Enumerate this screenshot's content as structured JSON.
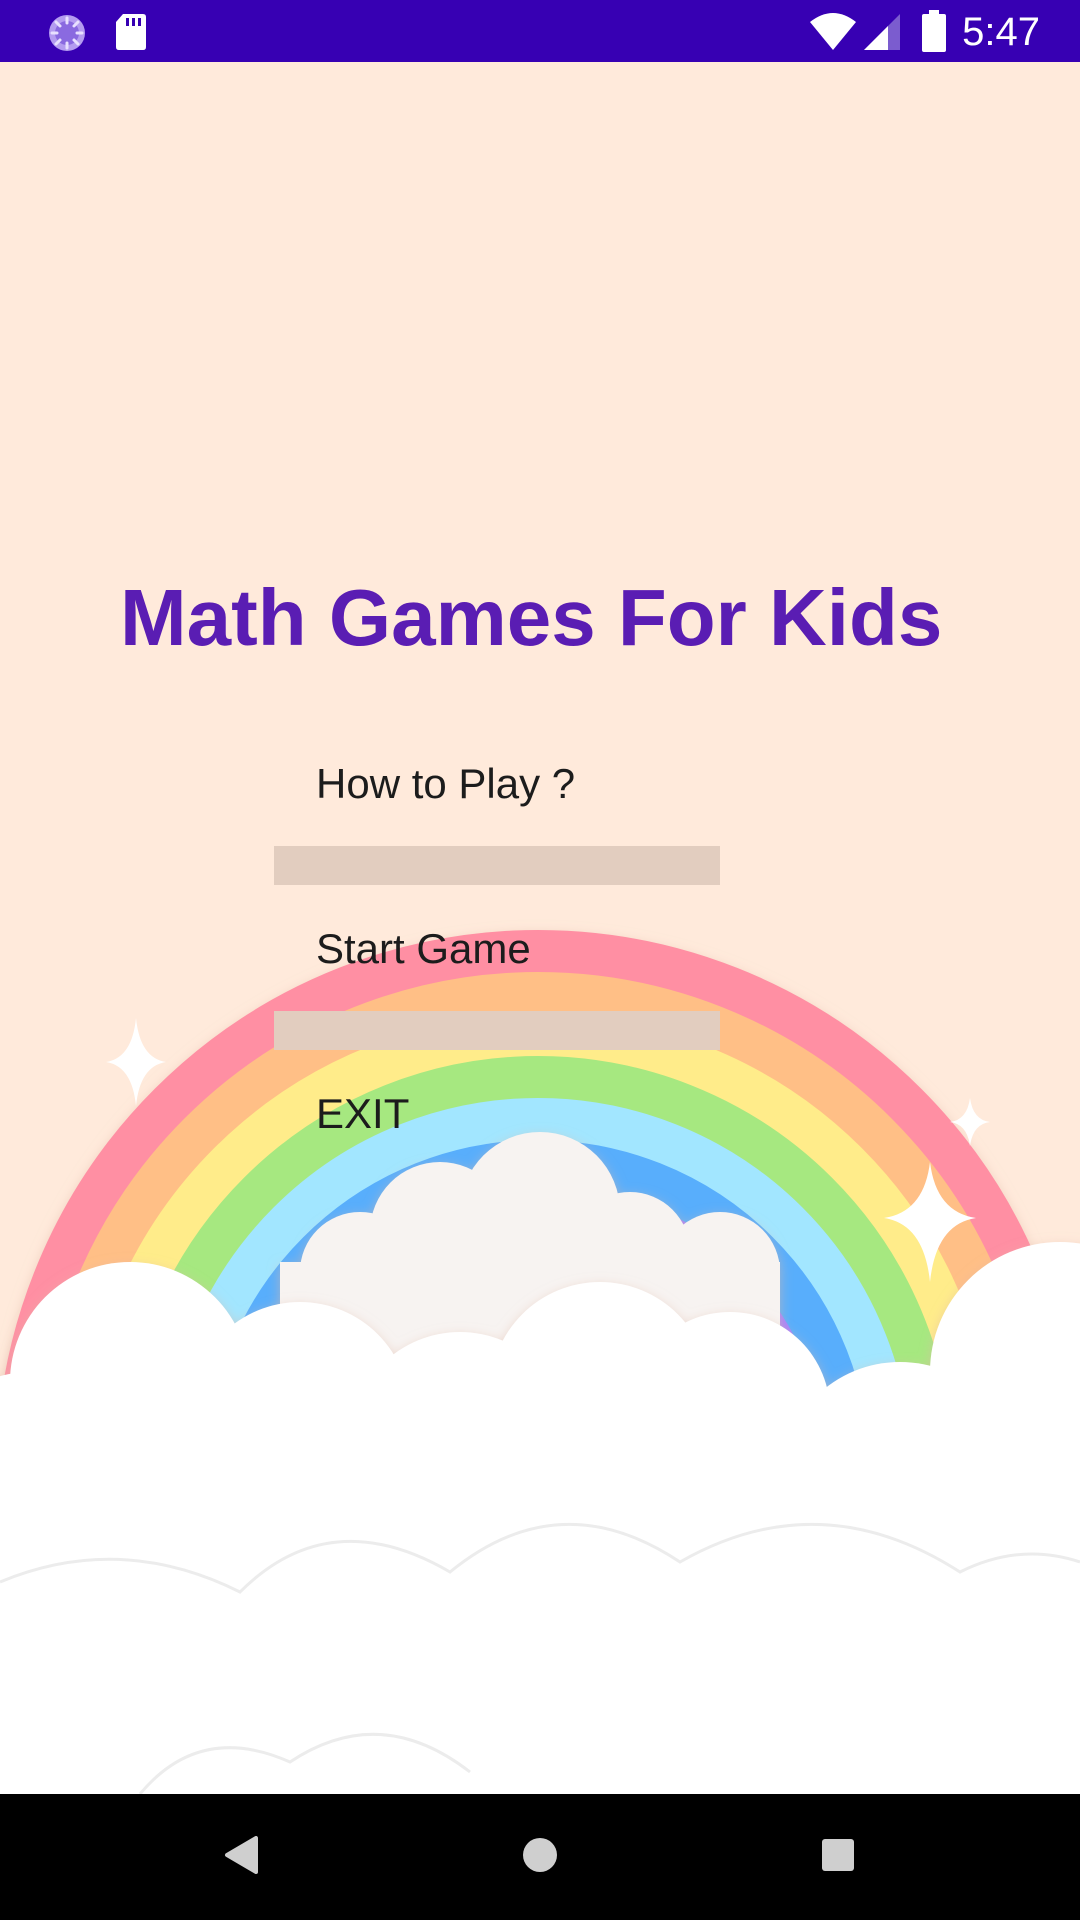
{
  "status_bar": {
    "time": "5:47",
    "background_color": "#3700b3",
    "left_icons": [
      "loading-icon",
      "sd-card-icon"
    ],
    "right_icons": [
      "wifi-icon",
      "signal-icon",
      "battery-icon"
    ]
  },
  "main": {
    "background_color": "#ffeadb",
    "title": "Math Games For Kids",
    "title_color": "#5a1db3",
    "buttons": [
      {
        "label": "How to Play ?"
      },
      {
        "label": "Start Game"
      },
      {
        "label": "EXIT"
      }
    ],
    "divider_color": "#e2cdbf",
    "background_illustration": "rainbow-clouds-sparkles"
  },
  "nav_bar": {
    "buttons": [
      "back-icon",
      "home-icon",
      "recents-icon"
    ]
  }
}
